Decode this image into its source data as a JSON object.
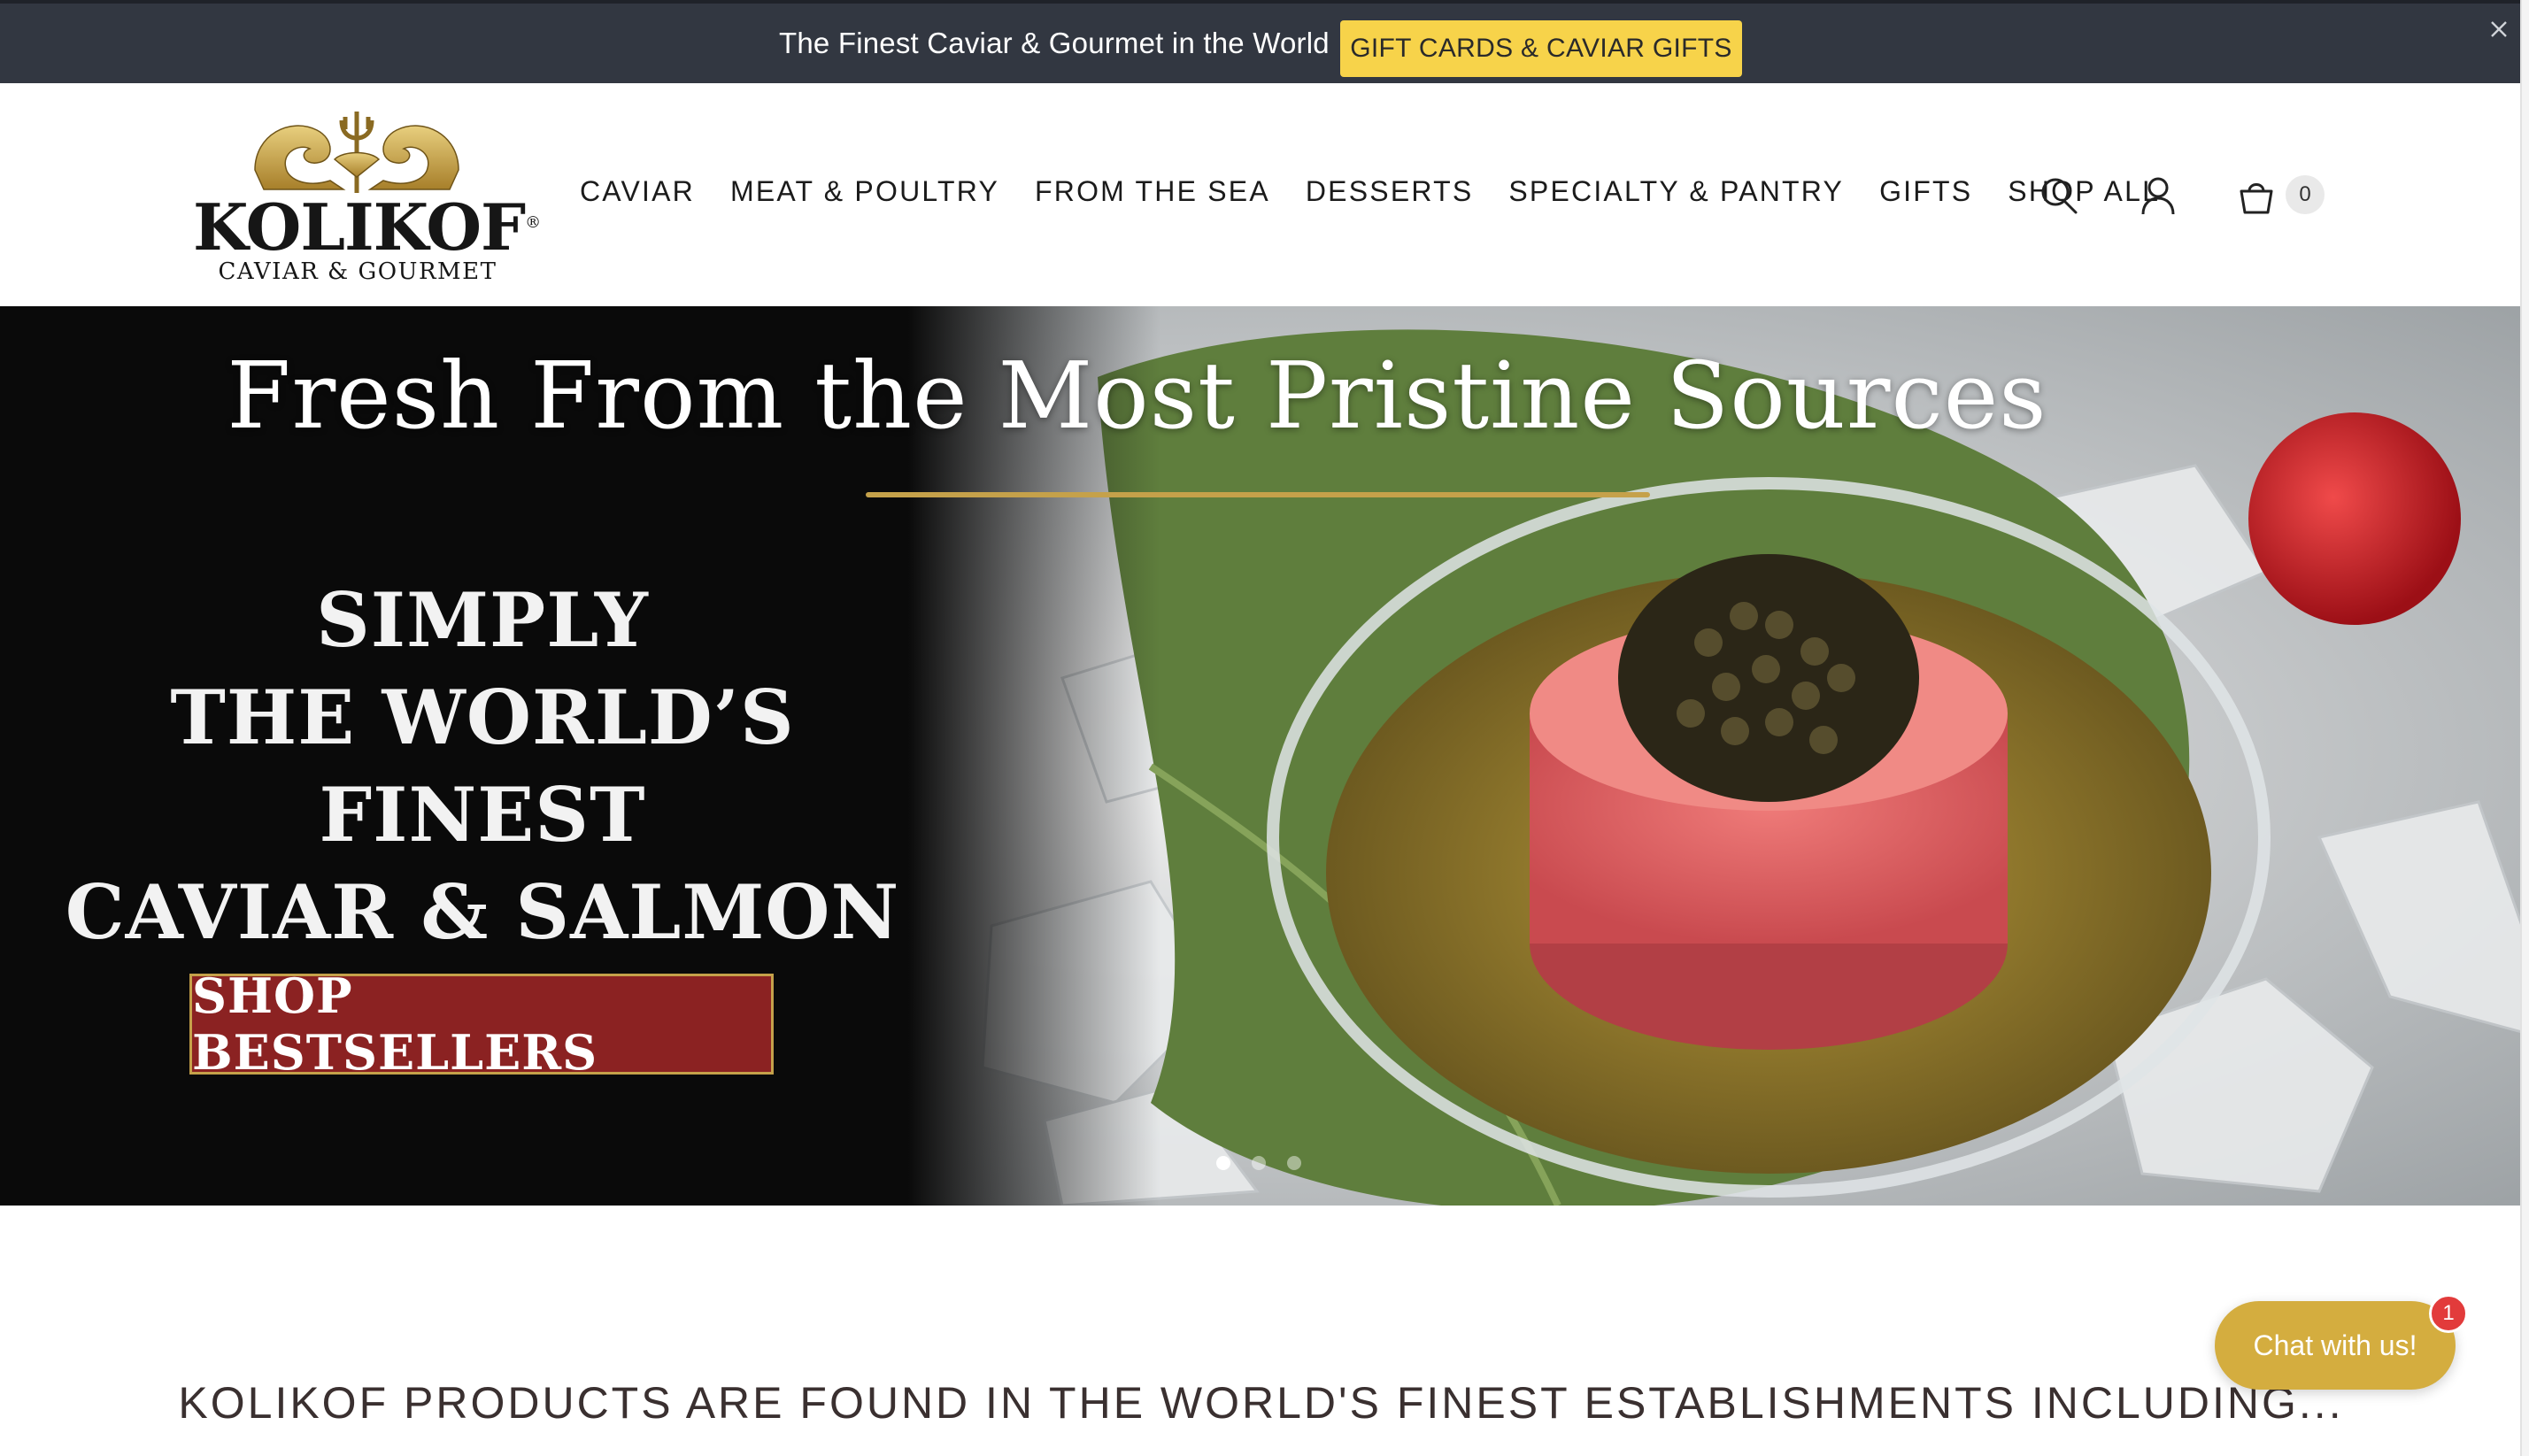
{
  "announcement": {
    "text": "The Finest Caviar & Gourmet in the World",
    "button_label": "GIFT CARDS & CAVIAR GIFTS",
    "close_icon": "close-icon"
  },
  "logo": {
    "name": "KOLIKOF",
    "tagline": "CAVIAR & GOURMET",
    "trademark": "®"
  },
  "nav": {
    "items": [
      {
        "label": "CAVIAR",
        "name": "nav-item-caviar"
      },
      {
        "label": "MEAT & POULTRY",
        "name": "nav-item-meat-poultry"
      },
      {
        "label": "FROM THE SEA",
        "name": "nav-item-from-the-sea"
      },
      {
        "label": "DESSERTS",
        "name": "nav-item-desserts"
      },
      {
        "label": "SPECIALTY & PANTRY",
        "name": "nav-item-specialty-pantry"
      },
      {
        "label": "GIFTS",
        "name": "nav-item-gifts"
      },
      {
        "label": "SHOP ALL",
        "name": "nav-item-shop-all"
      }
    ],
    "icons": {
      "search": "search-icon",
      "account": "user-icon",
      "cart": "cart-icon"
    },
    "cart_count": "0"
  },
  "hero": {
    "title": "Fresh From the Most Pristine Sources",
    "lines": [
      "SIMPLY",
      "THE WORLD’S FINEST",
      "CAVIAR & SALMON"
    ],
    "cta_label": "SHOP BESTSELLERS",
    "slides": 3,
    "active_slide": 1
  },
  "establishments": {
    "heading": "KOLIKOF PRODUCTS ARE FOUND IN THE WORLD'S FINEST ESTABLISHMENTS INCLUDING..."
  },
  "chat": {
    "label": "Chat with us!",
    "badge": "1"
  },
  "colors": {
    "announcement_bg": "#323741",
    "gift_button": "#f7d34a",
    "cta_red": "#8b2222",
    "gold": "#c5a14a",
    "chat": "#d4ad3f",
    "badge": "#e23b3b"
  }
}
